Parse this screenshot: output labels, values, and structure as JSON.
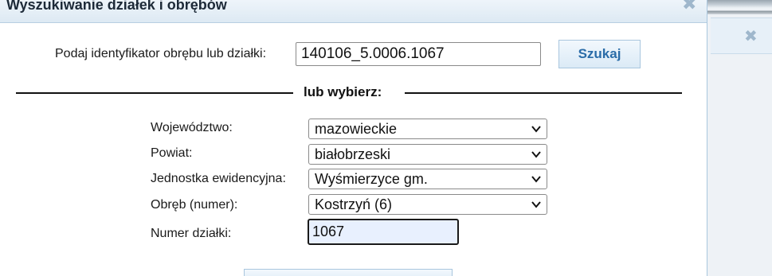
{
  "dialog": {
    "title": "Wyszukiwanie działek i obrębów"
  },
  "search": {
    "label": "Podaj identyfikator obrębu lub działki:",
    "value": "140106_5.0006.1067",
    "button_label": "Szukaj"
  },
  "separator": {
    "label": "lub wybierz:"
  },
  "fields": {
    "wojewodztwo": {
      "label": "Województwo:",
      "value": "mazowieckie"
    },
    "powiat": {
      "label": "Powiat:",
      "value": "białobrzeski"
    },
    "jednostka": {
      "label": "Jednostka ewidencyjna:",
      "value": "Wyśmierzyce gm."
    },
    "obreb": {
      "label": "Obręb (numer):",
      "value": "Kostrzyń (6)"
    },
    "numer": {
      "label": "Numer działki:",
      "value": "1067"
    }
  },
  "icons": {
    "close": "close-icon",
    "dropdown": "chevron-down-icon"
  },
  "colors": {
    "accent_text": "#2a6ca8",
    "button_bg": "#dbeaf6",
    "input_autofill_bg": "#e8f0fe"
  }
}
